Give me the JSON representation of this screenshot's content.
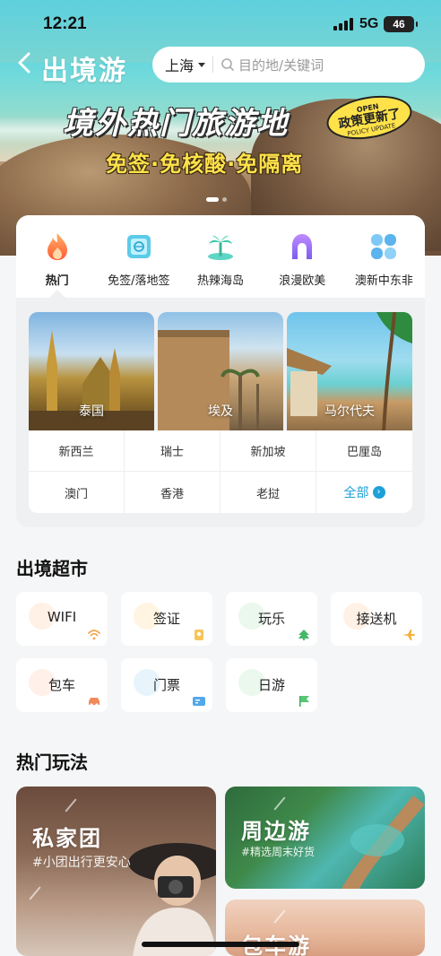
{
  "status": {
    "time": "12:21",
    "network": "5G",
    "battery": "46"
  },
  "nav": {
    "title": "出境游",
    "city": "上海",
    "search_placeholder": "目的地/关键词"
  },
  "banner": {
    "main": "境外热门旅游地",
    "sub": "免签·免核酸·免隔离",
    "badge_top": "OPEN",
    "badge_main": "政策更新了",
    "badge_bottom": "POLICY UPDATE",
    "page_count": 2,
    "active_page": 1
  },
  "categories": [
    {
      "label": "热门",
      "icon": "fire-icon",
      "active": true
    },
    {
      "label": "免签/落地签",
      "icon": "passport-icon",
      "active": false
    },
    {
      "label": "热辣海岛",
      "icon": "palm-island-icon",
      "active": false
    },
    {
      "label": "浪漫欧美",
      "icon": "arch-icon",
      "active": false
    },
    {
      "label": "澳新中东非",
      "icon": "globe-tiles-icon",
      "active": false
    }
  ],
  "featured": [
    {
      "name": "泰国"
    },
    {
      "name": "埃及"
    },
    {
      "name": "马尔代夫"
    }
  ],
  "cities": [
    "新西兰",
    "瑞士",
    "新加坡",
    "巴厘岛",
    "澳门",
    "香港",
    "老挝"
  ],
  "all_label": "全部",
  "supermarket": {
    "title": "出境超市",
    "items": [
      {
        "label": "WIFI",
        "icon": "wifi-icon"
      },
      {
        "label": "签证",
        "icon": "visa-icon"
      },
      {
        "label": "玩乐",
        "icon": "playground-icon"
      },
      {
        "label": "接送机",
        "icon": "plane-icon"
      },
      {
        "label": "包车",
        "icon": "car-icon"
      },
      {
        "label": "门票",
        "icon": "ticket-icon"
      },
      {
        "label": "日游",
        "icon": "flag-icon"
      }
    ]
  },
  "hot_play": {
    "title": "热门玩法",
    "cards": [
      {
        "title": "私家团",
        "subtitle": "#小团出行更安心"
      },
      {
        "title": "周边游",
        "subtitle": "#精选周末好货"
      },
      {
        "title": "包车游"
      }
    ]
  },
  "colors": {
    "accent": "#1ea0d8",
    "banner_yellow": "#ffe24a"
  }
}
